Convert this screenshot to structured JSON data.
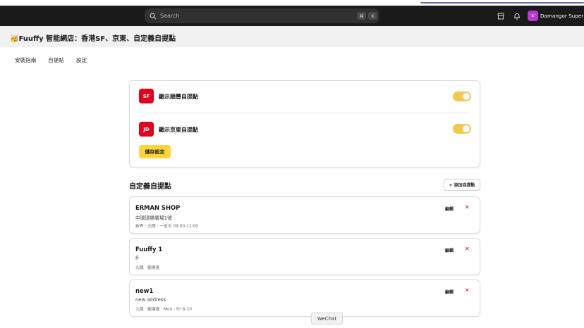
{
  "adminbar": {
    "search_placeholder": "Search",
    "kbd_cmd": "⌘",
    "kbd_k": "K",
    "user_avatar_text": "ᵔᴥᵔ",
    "user_name": "Damangor Super Pow"
  },
  "app": {
    "title": "🥳Fuuffy 智能網店：香港SF、京東、自定義自提點"
  },
  "tabs": [
    {
      "label": "安裝指南"
    },
    {
      "label": "自提點"
    },
    {
      "label": "設定"
    }
  ],
  "settings": {
    "sf": {
      "badge": "SF",
      "label": "顯示順豐自提點",
      "enabled": true
    },
    "jd": {
      "badge": "JD",
      "label": "顯示京東自提點",
      "enabled": true
    },
    "save_label": "儲存設定"
  },
  "custom_points": {
    "title": "自定義自提點",
    "add_label": "+ 添加自提點",
    "edit_label": "編輯",
    "delete_label": "✕",
    "items": [
      {
        "name": "ERMAN SHOP",
        "address": "中環環樂廣場1號",
        "meta": "新界 · 元朗 · 一至五 09:00-11:00"
      },
      {
        "name": "Fuuffy 1",
        "address": "ff",
        "meta": "九龍 · 觀塘區"
      },
      {
        "name": "new1",
        "address": "new address",
        "meta": "九龍 · 觀塘區 · Mon - Fri 8-10"
      }
    ]
  },
  "wechat_label": "WeChat",
  "colors": {
    "accent_yellow": "#ffd43b",
    "brand_red": "#e1001e",
    "admin_bar": "#1a1a1a"
  }
}
